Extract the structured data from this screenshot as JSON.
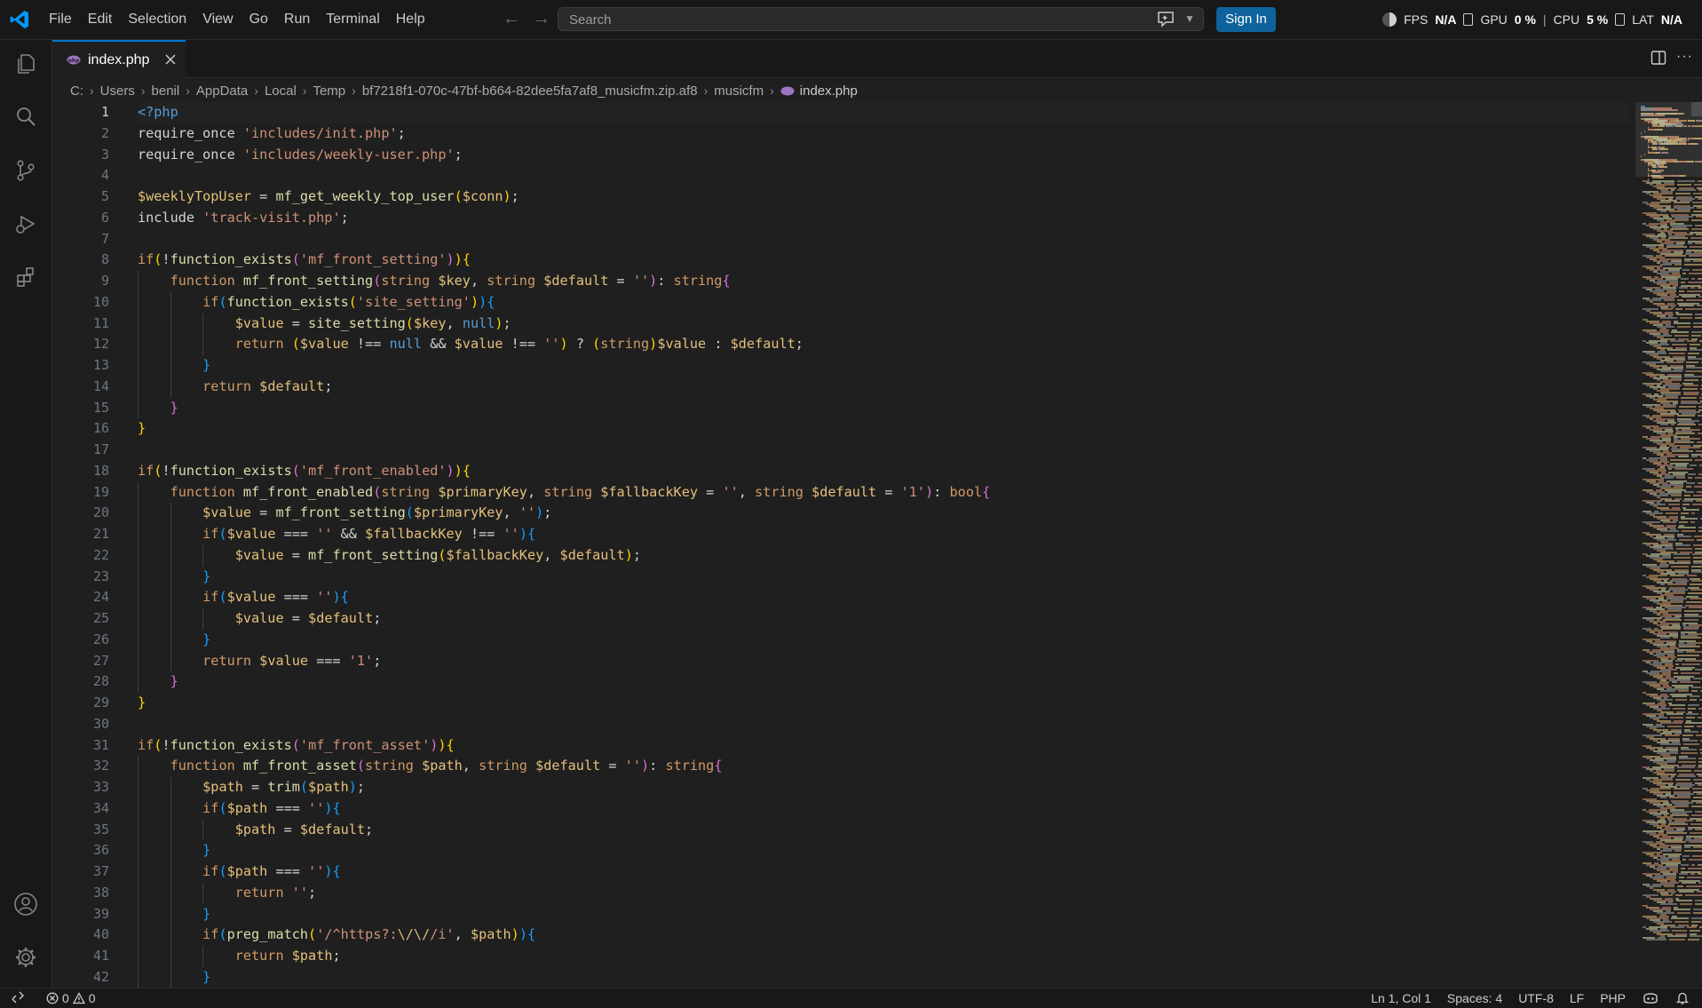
{
  "menu": [
    "File",
    "Edit",
    "Selection",
    "View",
    "Go",
    "Run",
    "Terminal",
    "Help"
  ],
  "search": {
    "placeholder": "Search"
  },
  "signin_label": "Sign In",
  "perf": {
    "fps_label": "FPS",
    "fps_value": "N/A",
    "gpu_label": "GPU",
    "gpu_value": "0 %",
    "separator": "|",
    "cpu_label": "CPU",
    "cpu_value": "5 %",
    "lat_label": "LAT",
    "lat_value": "N/A"
  },
  "tab": {
    "label": "index.php"
  },
  "breadcrumb": [
    "C:",
    "Users",
    "benil",
    "AppData",
    "Local",
    "Temp",
    "bf7218f1-070c-47bf-b664-82dee5fa7af8_musicfm.zip.af8",
    "musicfm",
    "index.php"
  ],
  "editor": {
    "active_line": 1,
    "lines": [
      [
        [
          "tk-tag",
          "<?php"
        ]
      ],
      [
        [
          "tk-txt",
          "require_once "
        ],
        [
          "tk-str",
          "'includes/init.php'"
        ],
        [
          "tk-txt",
          ";"
        ]
      ],
      [
        [
          "tk-txt",
          "require_once "
        ],
        [
          "tk-str",
          "'includes/weekly-user.php'"
        ],
        [
          "tk-txt",
          ";"
        ]
      ],
      [],
      [
        [
          "tk-var",
          "$weeklyTopUser"
        ],
        [
          "tk-txt",
          " = "
        ],
        [
          "tk-fn",
          "mf_get_weekly_top_user"
        ],
        [
          "tk-b1",
          "("
        ],
        [
          "tk-var",
          "$conn"
        ],
        [
          "tk-b1",
          ")"
        ],
        [
          "tk-txt",
          ";"
        ]
      ],
      [
        [
          "tk-txt",
          "include "
        ],
        [
          "tk-str",
          "'track-visit.php'"
        ],
        [
          "tk-txt",
          ";"
        ]
      ],
      [],
      [
        [
          "tk-kw2",
          "if"
        ],
        [
          "tk-b1",
          "("
        ],
        [
          "tk-txt",
          "!"
        ],
        [
          "tk-fn",
          "function_exists"
        ],
        [
          "tk-b2",
          "("
        ],
        [
          "tk-str",
          "'mf_front_setting'"
        ],
        [
          "tk-b2",
          ")"
        ],
        [
          "tk-b1",
          ")"
        ],
        [
          "tk-b1",
          "{"
        ]
      ],
      [
        [
          "tk-txt",
          "    "
        ],
        [
          "tk-kw2",
          "function "
        ],
        [
          "tk-fn",
          "mf_front_setting"
        ],
        [
          "tk-b2",
          "("
        ],
        [
          "tk-kw2",
          "string "
        ],
        [
          "tk-var",
          "$key"
        ],
        [
          "tk-txt",
          ", "
        ],
        [
          "tk-kw2",
          "string "
        ],
        [
          "tk-var",
          "$default"
        ],
        [
          "tk-txt",
          " = "
        ],
        [
          "tk-str",
          "''"
        ],
        [
          "tk-b2",
          ")"
        ],
        [
          "tk-txt",
          ": "
        ],
        [
          "tk-kw2",
          "string"
        ],
        [
          "tk-b2",
          "{"
        ]
      ],
      [
        [
          "tk-txt",
          "        "
        ],
        [
          "tk-kw2",
          "if"
        ],
        [
          "tk-b3",
          "("
        ],
        [
          "tk-fn",
          "function_exists"
        ],
        [
          "tk-b1",
          "("
        ],
        [
          "tk-str",
          "'site_setting'"
        ],
        [
          "tk-b1",
          ")"
        ],
        [
          "tk-b3",
          ")"
        ],
        [
          "tk-b3",
          "{"
        ]
      ],
      [
        [
          "tk-txt",
          "            "
        ],
        [
          "tk-var",
          "$value"
        ],
        [
          "tk-txt",
          " = "
        ],
        [
          "tk-fn",
          "site_setting"
        ],
        [
          "tk-b1",
          "("
        ],
        [
          "tk-var",
          "$key"
        ],
        [
          "tk-txt",
          ", "
        ],
        [
          "tk-null",
          "null"
        ],
        [
          "tk-b1",
          ")"
        ],
        [
          "tk-txt",
          ";"
        ]
      ],
      [
        [
          "tk-txt",
          "            "
        ],
        [
          "tk-kw2",
          "return "
        ],
        [
          "tk-b1",
          "("
        ],
        [
          "tk-var",
          "$value"
        ],
        [
          "tk-txt",
          " !== "
        ],
        [
          "tk-null",
          "null"
        ],
        [
          "tk-txt",
          " && "
        ],
        [
          "tk-var",
          "$value"
        ],
        [
          "tk-txt",
          " !== "
        ],
        [
          "tk-str",
          "''"
        ],
        [
          "tk-b1",
          ")"
        ],
        [
          "tk-txt",
          " ? "
        ],
        [
          "tk-b1",
          "("
        ],
        [
          "tk-kw2",
          "string"
        ],
        [
          "tk-b1",
          ")"
        ],
        [
          "tk-var",
          "$value"
        ],
        [
          "tk-txt",
          " : "
        ],
        [
          "tk-var",
          "$default"
        ],
        [
          "tk-txt",
          ";"
        ]
      ],
      [
        [
          "tk-txt",
          "        "
        ],
        [
          "tk-b3",
          "}"
        ]
      ],
      [
        [
          "tk-txt",
          "        "
        ],
        [
          "tk-kw2",
          "return "
        ],
        [
          "tk-var",
          "$default"
        ],
        [
          "tk-txt",
          ";"
        ]
      ],
      [
        [
          "tk-txt",
          "    "
        ],
        [
          "tk-b2",
          "}"
        ]
      ],
      [
        [
          "tk-b1",
          "}"
        ]
      ],
      [],
      [
        [
          "tk-kw2",
          "if"
        ],
        [
          "tk-b1",
          "("
        ],
        [
          "tk-txt",
          "!"
        ],
        [
          "tk-fn",
          "function_exists"
        ],
        [
          "tk-b2",
          "("
        ],
        [
          "tk-str",
          "'mf_front_enabled'"
        ],
        [
          "tk-b2",
          ")"
        ],
        [
          "tk-b1",
          ")"
        ],
        [
          "tk-b1",
          "{"
        ]
      ],
      [
        [
          "tk-txt",
          "    "
        ],
        [
          "tk-kw2",
          "function "
        ],
        [
          "tk-fn",
          "mf_front_enabled"
        ],
        [
          "tk-b2",
          "("
        ],
        [
          "tk-kw2",
          "string "
        ],
        [
          "tk-var",
          "$primaryKey"
        ],
        [
          "tk-txt",
          ", "
        ],
        [
          "tk-kw2",
          "string "
        ],
        [
          "tk-var",
          "$fallbackKey"
        ],
        [
          "tk-txt",
          " = "
        ],
        [
          "tk-str",
          "''"
        ],
        [
          "tk-txt",
          ", "
        ],
        [
          "tk-kw2",
          "string "
        ],
        [
          "tk-var",
          "$default"
        ],
        [
          "tk-txt",
          " = "
        ],
        [
          "tk-str",
          "'1'"
        ],
        [
          "tk-b2",
          ")"
        ],
        [
          "tk-txt",
          ": "
        ],
        [
          "tk-kw2",
          "bool"
        ],
        [
          "tk-b2",
          "{"
        ]
      ],
      [
        [
          "tk-txt",
          "        "
        ],
        [
          "tk-var",
          "$value"
        ],
        [
          "tk-txt",
          " = "
        ],
        [
          "tk-fn",
          "mf_front_setting"
        ],
        [
          "tk-b3",
          "("
        ],
        [
          "tk-var",
          "$primaryKey"
        ],
        [
          "tk-txt",
          ", "
        ],
        [
          "tk-str",
          "''"
        ],
        [
          "tk-b3",
          ")"
        ],
        [
          "tk-txt",
          ";"
        ]
      ],
      [
        [
          "tk-txt",
          "        "
        ],
        [
          "tk-kw2",
          "if"
        ],
        [
          "tk-b3",
          "("
        ],
        [
          "tk-var",
          "$value"
        ],
        [
          "tk-txt",
          " === "
        ],
        [
          "tk-str",
          "''"
        ],
        [
          "tk-txt",
          " && "
        ],
        [
          "tk-var",
          "$fallbackKey"
        ],
        [
          "tk-txt",
          " !== "
        ],
        [
          "tk-str",
          "''"
        ],
        [
          "tk-b3",
          ")"
        ],
        [
          "tk-b3",
          "{"
        ]
      ],
      [
        [
          "tk-txt",
          "            "
        ],
        [
          "tk-var",
          "$value"
        ],
        [
          "tk-txt",
          " = "
        ],
        [
          "tk-fn",
          "mf_front_setting"
        ],
        [
          "tk-b1",
          "("
        ],
        [
          "tk-var",
          "$fallbackKey"
        ],
        [
          "tk-txt",
          ", "
        ],
        [
          "tk-var",
          "$default"
        ],
        [
          "tk-b1",
          ")"
        ],
        [
          "tk-txt",
          ";"
        ]
      ],
      [
        [
          "tk-txt",
          "        "
        ],
        [
          "tk-b3",
          "}"
        ]
      ],
      [
        [
          "tk-txt",
          "        "
        ],
        [
          "tk-kw2",
          "if"
        ],
        [
          "tk-b3",
          "("
        ],
        [
          "tk-var",
          "$value"
        ],
        [
          "tk-txt",
          " === "
        ],
        [
          "tk-str",
          "''"
        ],
        [
          "tk-b3",
          ")"
        ],
        [
          "tk-b3",
          "{"
        ]
      ],
      [
        [
          "tk-txt",
          "            "
        ],
        [
          "tk-var",
          "$value"
        ],
        [
          "tk-txt",
          " = "
        ],
        [
          "tk-var",
          "$default"
        ],
        [
          "tk-txt",
          ";"
        ]
      ],
      [
        [
          "tk-txt",
          "        "
        ],
        [
          "tk-b3",
          "}"
        ]
      ],
      [
        [
          "tk-txt",
          "        "
        ],
        [
          "tk-kw2",
          "return "
        ],
        [
          "tk-var",
          "$value"
        ],
        [
          "tk-txt",
          " === "
        ],
        [
          "tk-str",
          "'1'"
        ],
        [
          "tk-txt",
          ";"
        ]
      ],
      [
        [
          "tk-txt",
          "    "
        ],
        [
          "tk-b2",
          "}"
        ]
      ],
      [
        [
          "tk-b1",
          "}"
        ]
      ],
      [],
      [
        [
          "tk-kw2",
          "if"
        ],
        [
          "tk-b1",
          "("
        ],
        [
          "tk-txt",
          "!"
        ],
        [
          "tk-fn",
          "function_exists"
        ],
        [
          "tk-b2",
          "("
        ],
        [
          "tk-str",
          "'mf_front_asset'"
        ],
        [
          "tk-b2",
          ")"
        ],
        [
          "tk-b1",
          ")"
        ],
        [
          "tk-b1",
          "{"
        ]
      ],
      [
        [
          "tk-txt",
          "    "
        ],
        [
          "tk-kw2",
          "function "
        ],
        [
          "tk-fn",
          "mf_front_asset"
        ],
        [
          "tk-b2",
          "("
        ],
        [
          "tk-kw2",
          "string "
        ],
        [
          "tk-var",
          "$path"
        ],
        [
          "tk-txt",
          ", "
        ],
        [
          "tk-kw2",
          "string "
        ],
        [
          "tk-var",
          "$default"
        ],
        [
          "tk-txt",
          " = "
        ],
        [
          "tk-str",
          "''"
        ],
        [
          "tk-b2",
          ")"
        ],
        [
          "tk-txt",
          ": "
        ],
        [
          "tk-kw2",
          "string"
        ],
        [
          "tk-b2",
          "{"
        ]
      ],
      [
        [
          "tk-txt",
          "        "
        ],
        [
          "tk-var",
          "$path"
        ],
        [
          "tk-txt",
          " = "
        ],
        [
          "tk-fn",
          "trim"
        ],
        [
          "tk-b3",
          "("
        ],
        [
          "tk-var",
          "$path"
        ],
        [
          "tk-b3",
          ")"
        ],
        [
          "tk-txt",
          ";"
        ]
      ],
      [
        [
          "tk-txt",
          "        "
        ],
        [
          "tk-kw2",
          "if"
        ],
        [
          "tk-b3",
          "("
        ],
        [
          "tk-var",
          "$path"
        ],
        [
          "tk-txt",
          " === "
        ],
        [
          "tk-str",
          "''"
        ],
        [
          "tk-b3",
          ")"
        ],
        [
          "tk-b3",
          "{"
        ]
      ],
      [
        [
          "tk-txt",
          "            "
        ],
        [
          "tk-var",
          "$path"
        ],
        [
          "tk-txt",
          " = "
        ],
        [
          "tk-var",
          "$default"
        ],
        [
          "tk-txt",
          ";"
        ]
      ],
      [
        [
          "tk-txt",
          "        "
        ],
        [
          "tk-b3",
          "}"
        ]
      ],
      [
        [
          "tk-txt",
          "        "
        ],
        [
          "tk-kw2",
          "if"
        ],
        [
          "tk-b3",
          "("
        ],
        [
          "tk-var",
          "$path"
        ],
        [
          "tk-txt",
          " === "
        ],
        [
          "tk-str",
          "''"
        ],
        [
          "tk-b3",
          ")"
        ],
        [
          "tk-b3",
          "{"
        ]
      ],
      [
        [
          "tk-txt",
          "            "
        ],
        [
          "tk-kw2",
          "return "
        ],
        [
          "tk-str",
          "''"
        ],
        [
          "tk-txt",
          ";"
        ]
      ],
      [
        [
          "tk-txt",
          "        "
        ],
        [
          "tk-b3",
          "}"
        ]
      ],
      [
        [
          "tk-txt",
          "        "
        ],
        [
          "tk-kw2",
          "if"
        ],
        [
          "tk-b3",
          "("
        ],
        [
          "tk-fn",
          "preg_match"
        ],
        [
          "tk-b1",
          "("
        ],
        [
          "tk-str",
          "'/^https?:"
        ],
        [
          "tk-esc",
          "\\/\\/"
        ],
        [
          "tk-str",
          "/i'"
        ],
        [
          "tk-txt",
          ", "
        ],
        [
          "tk-var",
          "$path"
        ],
        [
          "tk-b1",
          ")"
        ],
        [
          "tk-b3",
          ")"
        ],
        [
          "tk-b3",
          "{"
        ]
      ],
      [
        [
          "tk-txt",
          "            "
        ],
        [
          "tk-kw2",
          "return "
        ],
        [
          "tk-var",
          "$path"
        ],
        [
          "tk-txt",
          ";"
        ]
      ],
      [
        [
          "tk-txt",
          "        "
        ],
        [
          "tk-b3",
          "}"
        ]
      ]
    ]
  },
  "status": {
    "errors": "0",
    "warnings": "0",
    "position": "Ln 1, Col 1",
    "spaces": "Spaces: 4",
    "encoding": "UTF-8",
    "eol": "LF",
    "language": "PHP"
  },
  "colors": {
    "accent": "#0078d4",
    "signin_bg": "#0e639c",
    "editor_bg": "#1f1f1f",
    "chrome_bg": "#181818"
  }
}
